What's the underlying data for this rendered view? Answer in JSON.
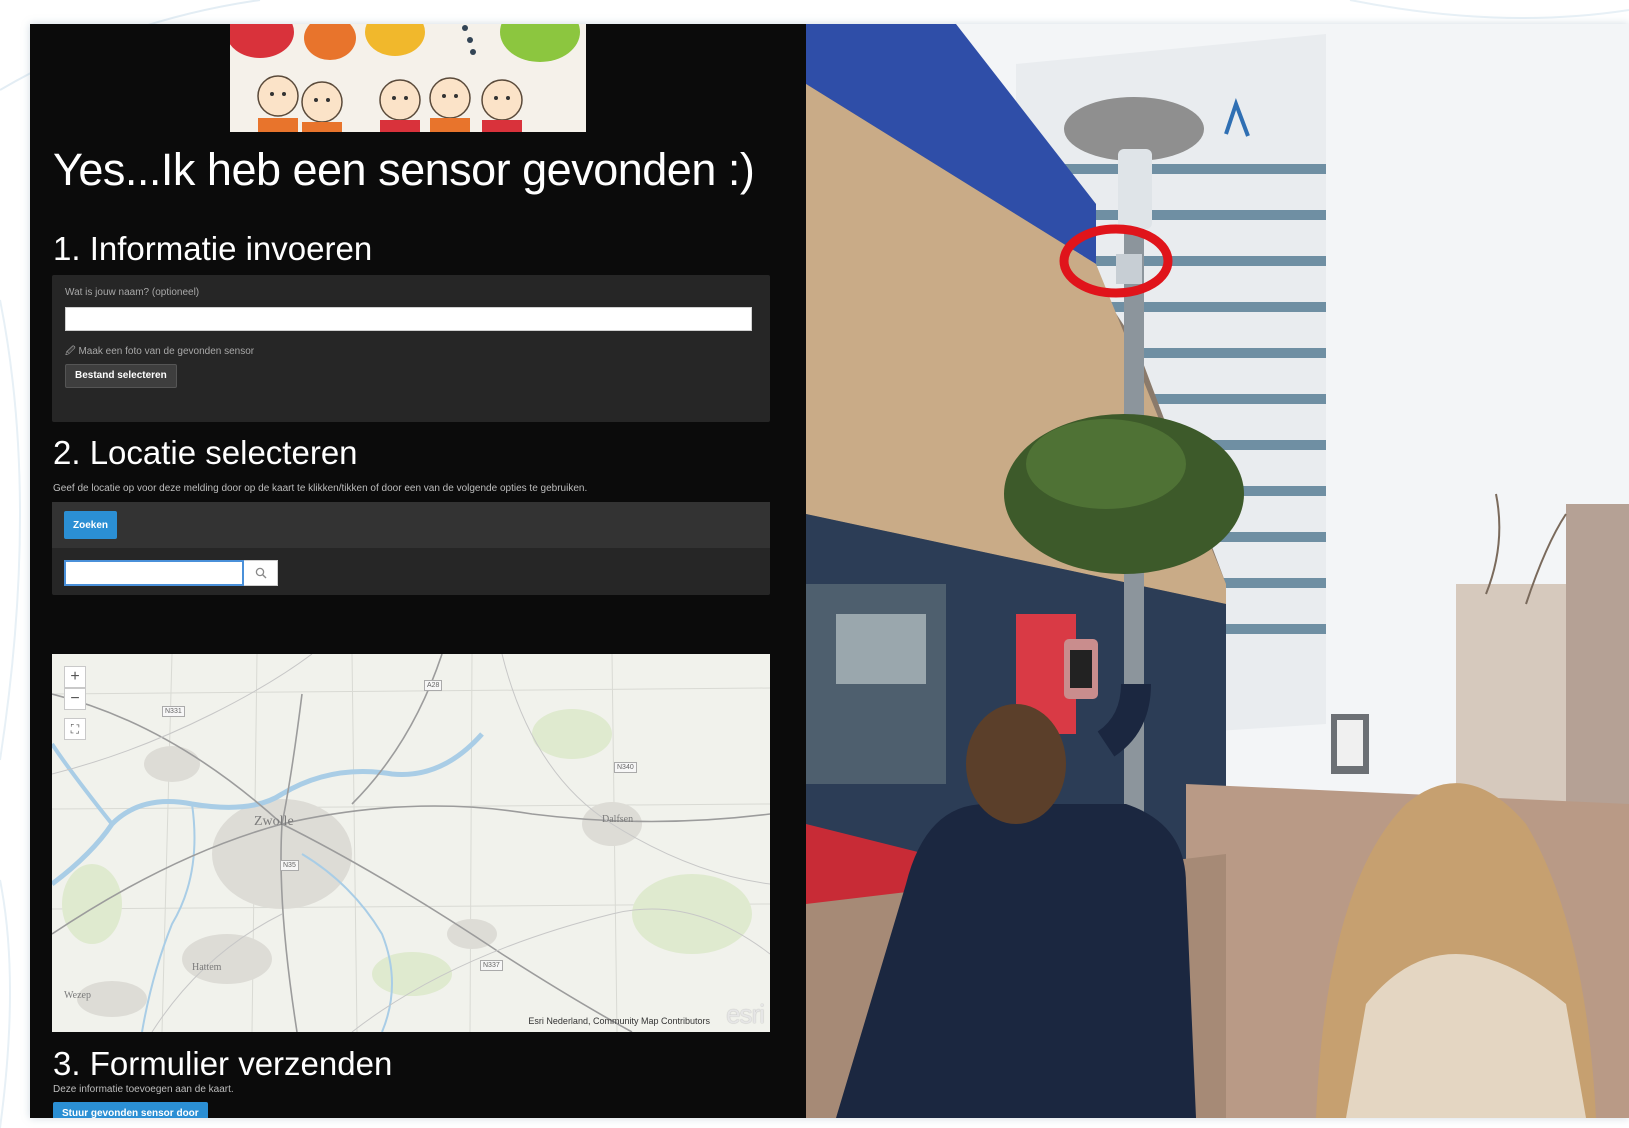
{
  "page_title": "Yes...Ik heb een sensor gevonden :)",
  "section1": {
    "title": "1. Informatie invoeren",
    "name_label": "Wat is jouw naam? (optioneel)",
    "name_value": "",
    "photo_label": "Maak een foto van de gevonden sensor",
    "file_button": "Bestand selecteren"
  },
  "section2": {
    "title": "2. Locatie selecteren",
    "help": "Geef de locatie op voor deze melding door op de kaart te klikken/tikken of door een van de volgende opties te gebruiken.",
    "search_button": "Zoeken",
    "search_value": "",
    "map": {
      "zoom_in": "+",
      "zoom_out": "−",
      "places": [
        "Zwolle",
        "Dalfsen",
        "Hattem",
        "Wezep"
      ],
      "roads": [
        "N331",
        "A28",
        "N340",
        "N35",
        "N337"
      ],
      "attribution": "Esri Nederland, Community Map Contributors",
      "logo": "esri"
    }
  },
  "section3": {
    "title": "3. Formulier verzenden",
    "help": "Deze informatie toevoegen aan de kaart.",
    "submit_button": "Stuur gevonden sensor door"
  },
  "colors": {
    "panel_bg": "#0b0b0b",
    "card_bg": "#262626",
    "accent_blue": "#2b8fd4",
    "highlight_ring": "#e0141b"
  }
}
